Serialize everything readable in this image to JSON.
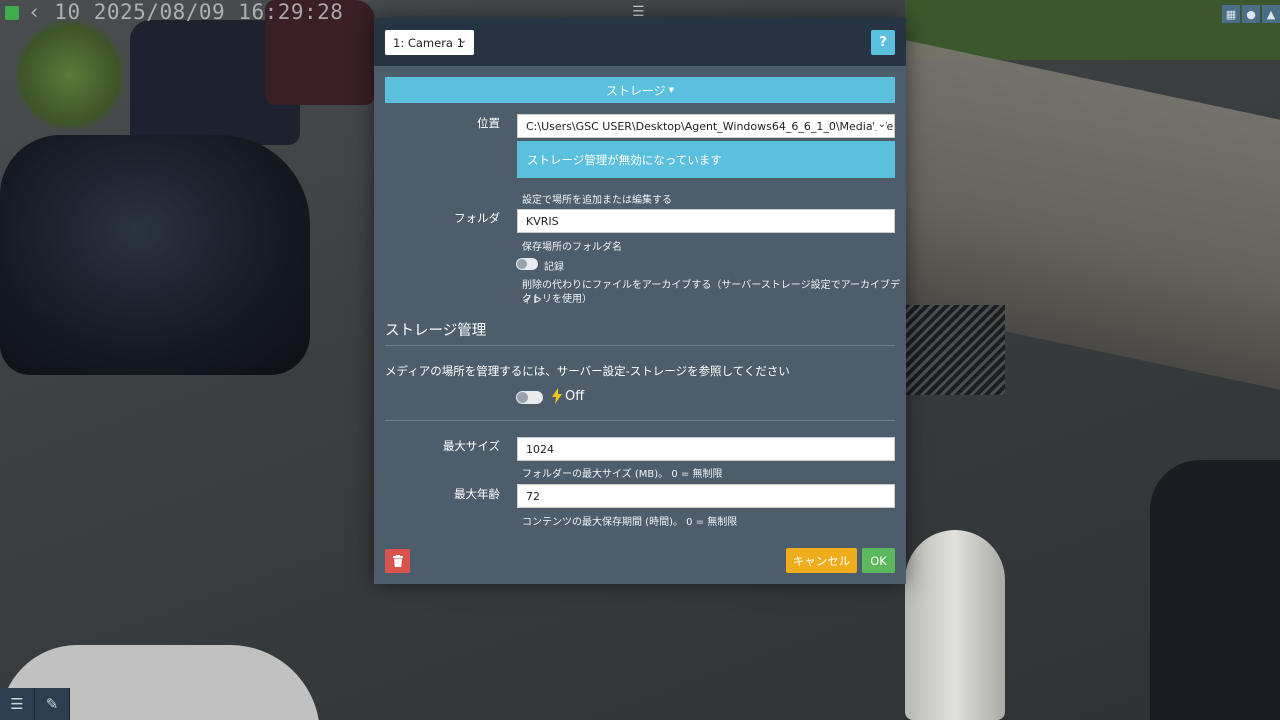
{
  "osd": {
    "timestamp": "10 2025/08/09 16:29:28"
  },
  "header": {
    "camera_select": "1: Camera 1",
    "help_label": "?"
  },
  "tab": {
    "label": "ストレージ"
  },
  "location": {
    "label": "位置",
    "value": "C:\\Users\\GSC USER\\Desktop\\Agent_Windows64_6_6_1_0\\Media\\WebSer",
    "alert": "ストレージ管理が無効になっています",
    "hint": "設定で場所を追加または編集する"
  },
  "folder": {
    "label": "フォルダ",
    "value": "KVRIS",
    "hint": "保存場所のフォルダ名",
    "record_label": "記録",
    "archive_hint_line1": "削除の代わりにファイルをアーカイブする（サーバーストレージ設定でアーカイブディレ",
    "archive_hint_line2": "クトリを使用）"
  },
  "storage_management": {
    "title": "ストレージ管理",
    "info": "メディアの場所を管理するには、サーバー設定-ストレージを参照してください",
    "toggle_state": "Off"
  },
  "max_size": {
    "label": "最大サイズ",
    "value": "1024",
    "hint": "フォルダーの最大サイズ (MB)。 0 = 無制限"
  },
  "max_age": {
    "label": "最大年齢",
    "value": "72",
    "hint": "コンテンツの最大保存期間 (時間)。 0 = 無制限"
  },
  "footer": {
    "cancel_label": "キャンセル",
    "ok_label": "OK"
  },
  "colors": {
    "info": "#5bc0de",
    "danger": "#d9534f",
    "warning": "#f0ad1b",
    "success": "#5cb85c",
    "bolt": "#f0c419"
  }
}
